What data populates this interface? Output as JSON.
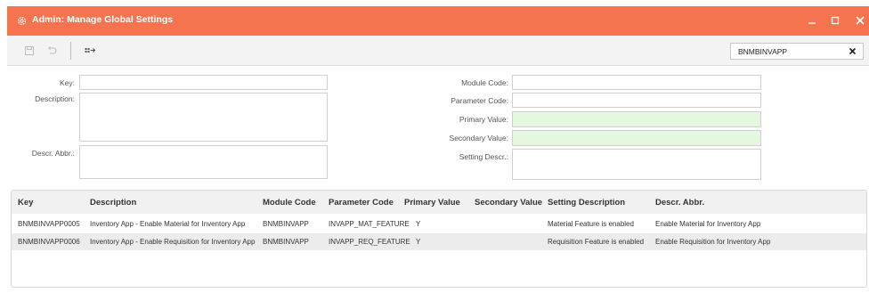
{
  "window": {
    "title": "Admin: Manage Global Settings",
    "accent_color": "#f6734f",
    "icons": [
      "gear-icon",
      "minimize-icon",
      "maximize-icon",
      "close-icon"
    ]
  },
  "toolbar": {
    "icons": [
      "save-icon",
      "undo-icon",
      "export-icon"
    ],
    "search_value": "BNMBINVAPP"
  },
  "form": {
    "key_label": "Key:",
    "description_label": "Description:",
    "descr_abbr_label": "Descr. Abbr.:",
    "module_code_label": "Module Code:",
    "parameter_code_label": "Parameter Code:",
    "primary_value_label": "Primary Value:",
    "secondary_value_label": "Secondary Value:",
    "setting_descr_label": "Setting Descr.:",
    "key_value": "",
    "description_value": "",
    "descr_abbr_value": "",
    "module_code_value": "",
    "parameter_code_value": "",
    "primary_value_value": "",
    "secondary_value_value": "",
    "setting_descr_value": ""
  },
  "grid": {
    "headers": {
      "key": "Key",
      "description": "Description",
      "module_code": "Module Code",
      "parameter_code": "Parameter Code",
      "primary_value": "Primary Value",
      "secondary_value": "Secondary Value",
      "setting_description": "Setting Description",
      "descr_abbr": "Descr. Abbr."
    },
    "rows": [
      {
        "key": "BNMBINVAPP0005",
        "description": "Inventory App - Enable Material for Inventory App",
        "module_code": "BNMBINVAPP",
        "parameter_code": "INVAPP_MAT_FEATURE",
        "primary_value": "Y",
        "secondary_value": "",
        "setting_description": "Material Feature is enabled",
        "descr_abbr": "Enable Material for Inventory App"
      },
      {
        "key": "BNMBINVAPP0006",
        "description": "Inventory App - Enable Requisition for Inventory App",
        "module_code": "BNMBINVAPP",
        "parameter_code": "INVAPP_REQ_FEATURE",
        "primary_value": "Y",
        "secondary_value": "",
        "setting_description": "Requisition Feature is enabled",
        "descr_abbr": "Enable Requisition for Inventory App"
      }
    ]
  }
}
